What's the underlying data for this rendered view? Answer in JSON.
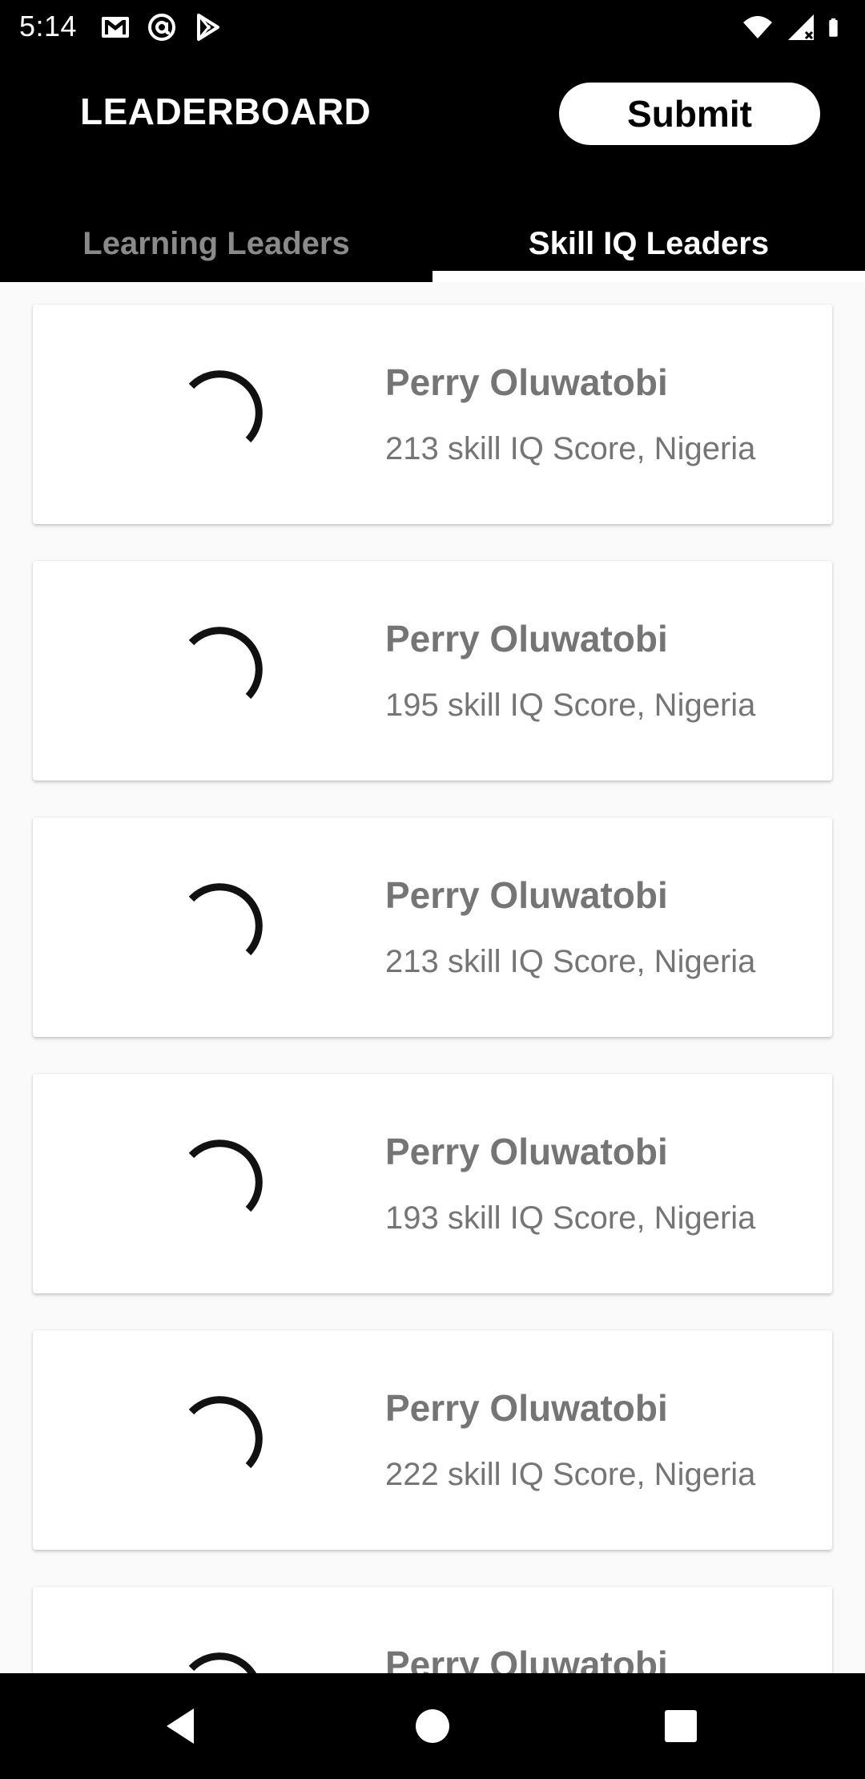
{
  "status_bar": {
    "time": "5:14",
    "icons_left": [
      "gmail-icon",
      "at-sign-icon",
      "play-store-icon"
    ],
    "icons_right": [
      "wifi-icon",
      "signal-icon",
      "battery-icon"
    ]
  },
  "header": {
    "title": "LEADERBOARD",
    "submit_label": "Submit"
  },
  "tabs": [
    {
      "label": "Learning Leaders",
      "selected": false
    },
    {
      "label": "Skill IQ Leaders",
      "selected": true
    }
  ],
  "leaders": [
    {
      "name": "Perry Oluwatobi",
      "score": "213 skill IQ Score, Nigeria"
    },
    {
      "name": "Perry Oluwatobi",
      "score": "195 skill IQ Score, Nigeria"
    },
    {
      "name": "Perry Oluwatobi",
      "score": "213 skill IQ Score, Nigeria"
    },
    {
      "name": "Perry Oluwatobi",
      "score": "193 skill IQ Score, Nigeria"
    },
    {
      "name": "Perry Oluwatobi",
      "score": "222 skill IQ Score, Nigeria"
    },
    {
      "name": "Perry Oluwatobi",
      "score": ""
    }
  ],
  "nav": [
    "back-icon",
    "home-icon",
    "recents-icon"
  ],
  "colors": {
    "header_bg": "#000000",
    "tab_inactive": "#8a8a8a",
    "card_text": "#757575",
    "page_bg": "#fafafa"
  }
}
